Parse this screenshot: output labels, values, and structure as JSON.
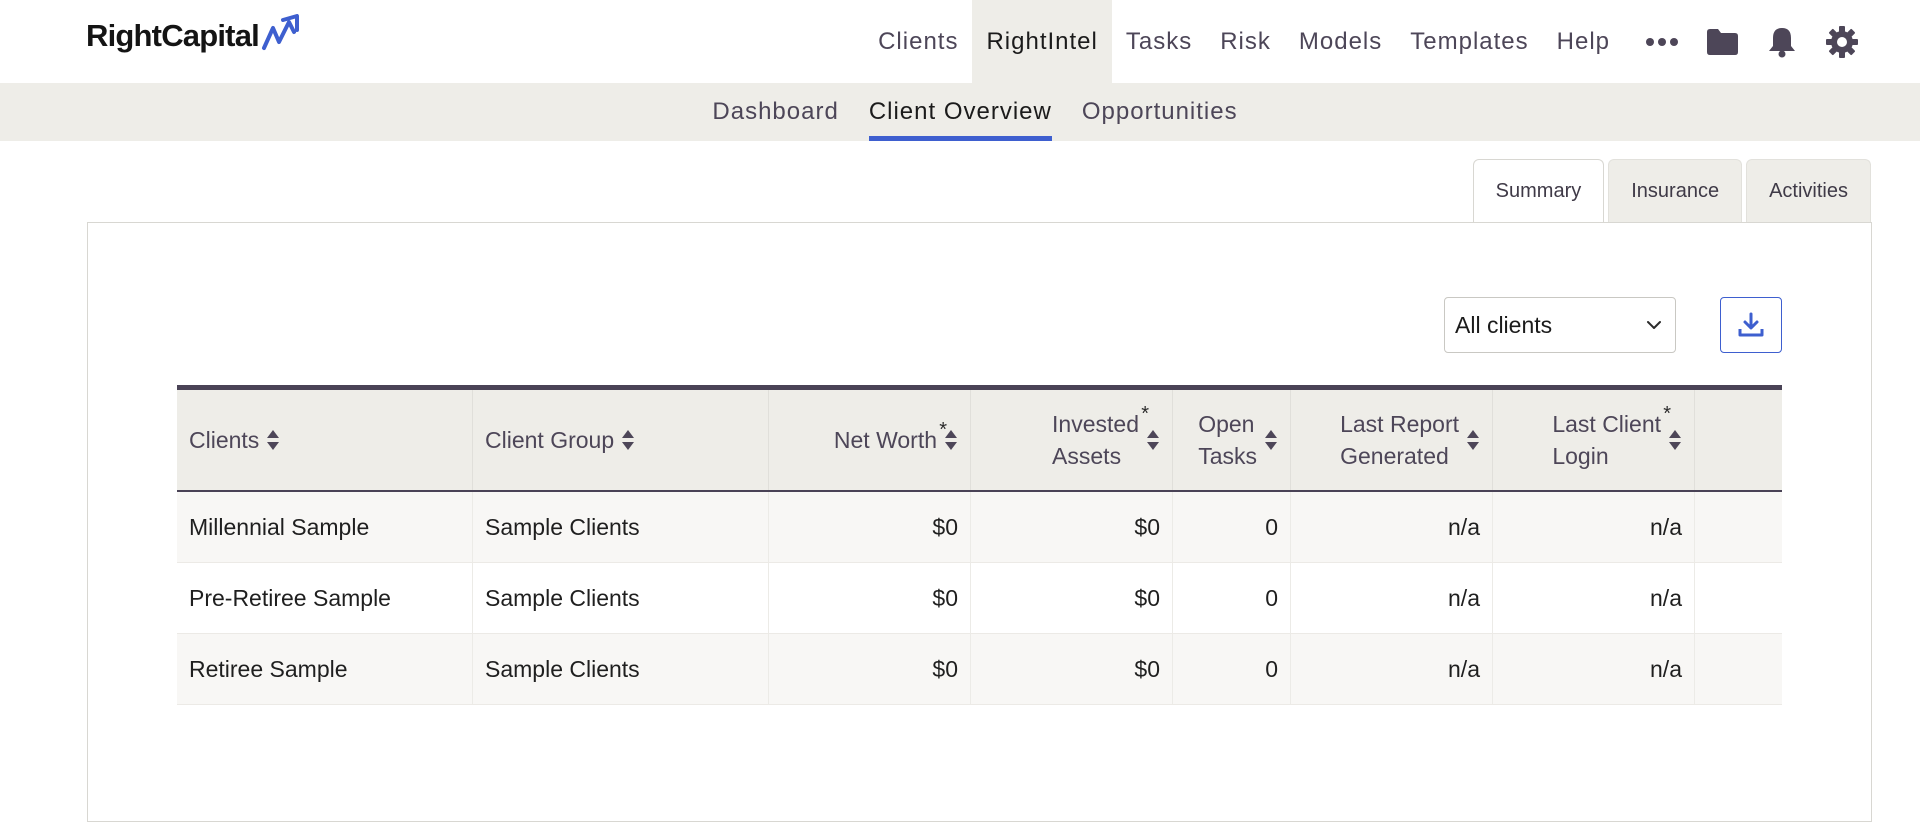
{
  "brand": {
    "name": "RightCapital",
    "accent": "#3e5fcf"
  },
  "nav": {
    "items": [
      "Clients",
      "RightIntel",
      "Tasks",
      "Risk",
      "Models",
      "Templates",
      "Help"
    ],
    "active": "RightIntel",
    "icons": [
      "more-icon",
      "folder-icon",
      "bell-icon",
      "gear-icon"
    ]
  },
  "subnav": {
    "items": [
      "Dashboard",
      "Client Overview",
      "Opportunities"
    ],
    "active": "Client Overview"
  },
  "tabs": {
    "items": [
      "Summary",
      "Insurance",
      "Activities"
    ],
    "active": "Summary"
  },
  "filter": {
    "selected": "All clients"
  },
  "table": {
    "columns": [
      {
        "label": "Clients",
        "line2": "",
        "starred": false
      },
      {
        "label": "Client Group",
        "line2": "",
        "starred": false
      },
      {
        "label": "Net Worth",
        "line2": "",
        "starred": true
      },
      {
        "label": "Invested",
        "line2": "Assets",
        "starred": true
      },
      {
        "label": "Open",
        "line2": "Tasks",
        "starred": false
      },
      {
        "label": "Last Report",
        "line2": "Generated",
        "starred": false
      },
      {
        "label": "Last Client",
        "line2": "Login",
        "starred": true
      }
    ],
    "rows": [
      [
        "Millennial Sample",
        "Sample Clients",
        "$0",
        "$0",
        "0",
        "n/a",
        "n/a"
      ],
      [
        "Pre-Retiree Sample",
        "Sample Clients",
        "$0",
        "$0",
        "0",
        "n/a",
        "n/a"
      ],
      [
        "Retiree Sample",
        "Sample Clients",
        "$0",
        "$0",
        "0",
        "n/a",
        "n/a"
      ]
    ]
  }
}
